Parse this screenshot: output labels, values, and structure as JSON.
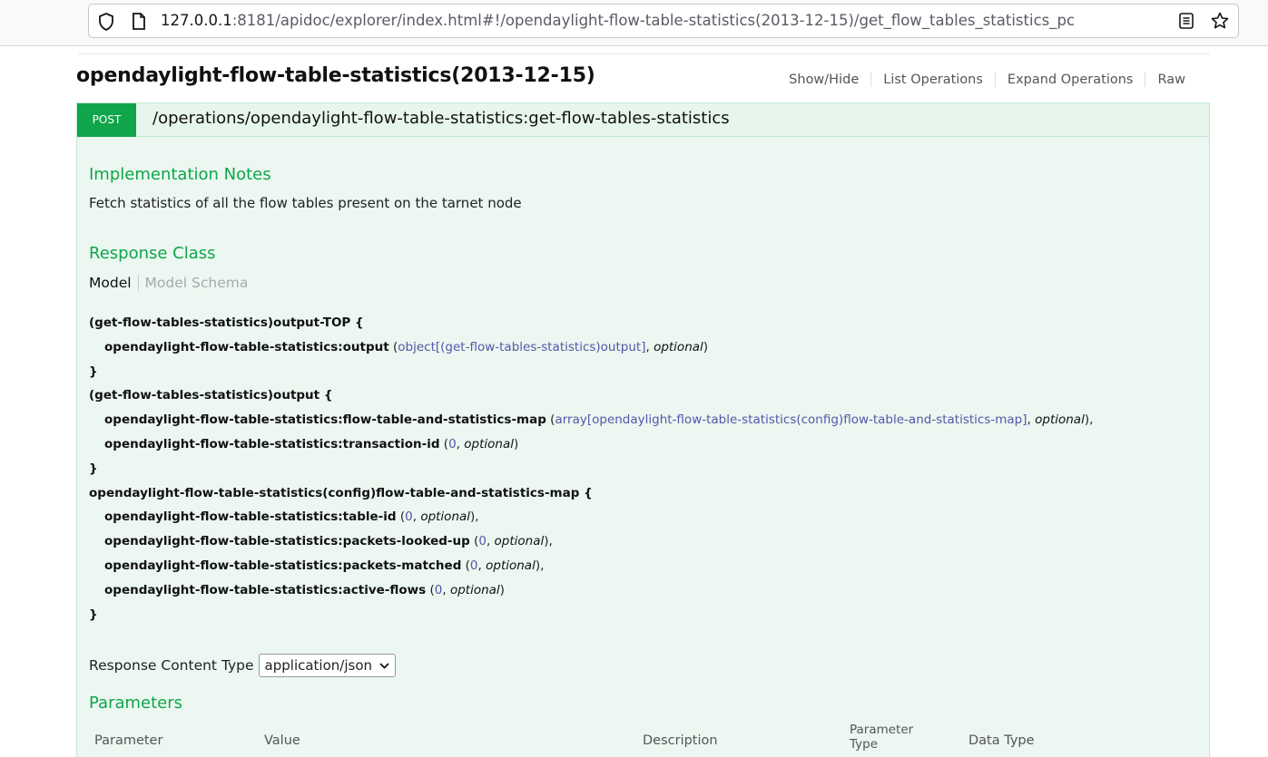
{
  "browser": {
    "url_host": "127.0.0.1",
    "url_rest": ":8181/apidoc/explorer/index.html#!/opendaylight-flow-table-statistics(2013-12-15)/get_flow_tables_statistics_pc"
  },
  "resource": {
    "title": "opendaylight-flow-table-statistics(2013-12-15)",
    "links": [
      "Show/Hide",
      "List Operations",
      "Expand Operations",
      "Raw"
    ]
  },
  "operation": {
    "method": "POST",
    "path": "/operations/opendaylight-flow-table-statistics:get-flow-tables-statistics",
    "impl_notes_heading": "Implementation Notes",
    "impl_notes": "Fetch statistics of all the flow tables present on the tarnet node",
    "response_class_heading": "Response Class",
    "model_tab": "Model",
    "schema_tab": "Model Schema",
    "model_lines": [
      {
        "indent": false,
        "name": "(get-flow-tables-statistics)output-TOP {",
        "type": "",
        "opt": "",
        "tail": ""
      },
      {
        "indent": true,
        "name": "opendaylight-flow-table-statistics:output",
        "type": "object[(get-flow-tables-statistics)output]",
        "opt": "optional",
        "tail": ")"
      },
      {
        "indent": false,
        "name": "}",
        "type": "",
        "opt": "",
        "tail": ""
      },
      {
        "indent": false,
        "name": "(get-flow-tables-statistics)output {",
        "type": "",
        "opt": "",
        "tail": ""
      },
      {
        "indent": true,
        "name": "opendaylight-flow-table-statistics:flow-table-and-statistics-map",
        "type": "array[opendaylight-flow-table-statistics(config)flow-table-and-statistics-map]",
        "opt": "optional",
        "tail": "),"
      },
      {
        "indent": true,
        "name": "opendaylight-flow-table-statistics:transaction-id",
        "type": "0",
        "opt": "optional",
        "tail": ")"
      },
      {
        "indent": false,
        "name": "}",
        "type": "",
        "opt": "",
        "tail": ""
      },
      {
        "indent": false,
        "name": "opendaylight-flow-table-statistics(config)flow-table-and-statistics-map {",
        "type": "",
        "opt": "",
        "tail": ""
      },
      {
        "indent": true,
        "name": "opendaylight-flow-table-statistics:table-id",
        "type": "0",
        "opt": "optional",
        "tail": "),"
      },
      {
        "indent": true,
        "name": "opendaylight-flow-table-statistics:packets-looked-up",
        "type": "0",
        "opt": "optional",
        "tail": "),"
      },
      {
        "indent": true,
        "name": "opendaylight-flow-table-statistics:packets-matched",
        "type": "0",
        "opt": "optional",
        "tail": "),"
      },
      {
        "indent": true,
        "name": "opendaylight-flow-table-statistics:active-flows",
        "type": "0",
        "opt": "optional",
        "tail": ")"
      },
      {
        "indent": false,
        "name": "}",
        "type": "",
        "opt": "",
        "tail": ""
      }
    ],
    "response_content_type_label": "Response Content Type",
    "response_content_type_value": "application/json",
    "parameters_heading": "Parameters",
    "param_headers": [
      "Parameter",
      "Value",
      "Description",
      "Parameter Type",
      "Data Type"
    ]
  },
  "colors": {
    "post_green": "#10a54a",
    "op_bg": "#ebf7f0",
    "type_link": "#5555aa"
  }
}
